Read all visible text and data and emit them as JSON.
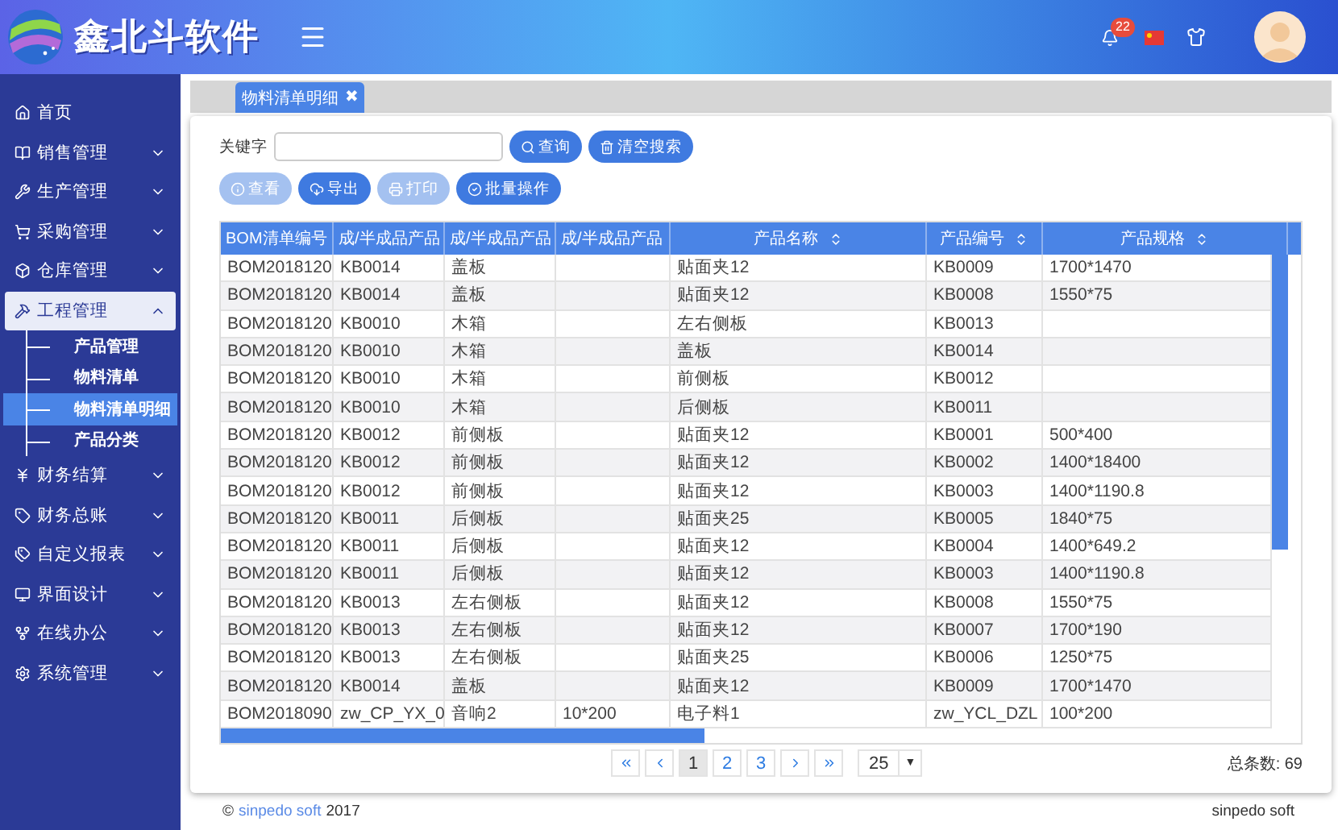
{
  "header": {
    "logo_text": "鑫北斗软件",
    "notifications": "22"
  },
  "sidebar": {
    "items": [
      {
        "label": "首页",
        "kind": "link"
      },
      {
        "label": "销售管理",
        "kind": "group",
        "expanded": false
      },
      {
        "label": "生产管理",
        "kind": "group",
        "expanded": false
      },
      {
        "label": "采购管理",
        "kind": "group",
        "expanded": false
      },
      {
        "label": "仓库管理",
        "kind": "group",
        "expanded": false
      },
      {
        "label": "工程管理",
        "kind": "group",
        "expanded": true,
        "children": [
          {
            "label": "产品管理",
            "selected": false
          },
          {
            "label": "物料清单",
            "selected": false
          },
          {
            "label": "物料清单明细",
            "selected": true
          },
          {
            "label": "产品分类",
            "selected": false
          }
        ]
      },
      {
        "label": "财务结算",
        "kind": "group",
        "expanded": false
      },
      {
        "label": "财务总账",
        "kind": "group",
        "expanded": false
      },
      {
        "label": "自定义报表",
        "kind": "group",
        "expanded": false
      },
      {
        "label": "界面设计",
        "kind": "group",
        "expanded": false
      },
      {
        "label": "在线办公",
        "kind": "group",
        "expanded": false
      },
      {
        "label": "系统管理",
        "kind": "group",
        "expanded": false
      }
    ]
  },
  "tabs": [
    {
      "label": "物料清单明细",
      "selected": true,
      "close": "✖"
    }
  ],
  "search": {
    "label": "关键字",
    "buttons": [
      "查询",
      "清空搜索"
    ]
  },
  "actions": [
    {
      "label": "查看",
      "disabled": true
    },
    {
      "label": "导出",
      "disabled": false
    },
    {
      "label": "打印",
      "disabled": true
    },
    {
      "label": "批量操作",
      "disabled": false
    }
  ],
  "table": {
    "columns": [
      {
        "label": "BOM清单编号",
        "sortable": false
      },
      {
        "label": "成/半成品产品",
        "sortable": false
      },
      {
        "label": "成/半成品产品",
        "sortable": false
      },
      {
        "label": "成/半成品产品",
        "sortable": false
      },
      {
        "label": "产品名称",
        "sortable": true
      },
      {
        "label": "产品编号",
        "sortable": true
      },
      {
        "label": "产品规格",
        "sortable": true
      }
    ],
    "rows": [
      [
        "BOM2018120",
        "KB0014",
        "盖板",
        "",
        "贴面夹12",
        "KB0009",
        "1700*1470"
      ],
      [
        "BOM2018120",
        "KB0014",
        "盖板",
        "",
        "贴面夹12",
        "KB0008",
        "1550*75"
      ],
      [
        "BOM2018120",
        "KB0010",
        "木箱",
        "",
        "左右侧板",
        "KB0013",
        ""
      ],
      [
        "BOM2018120",
        "KB0010",
        "木箱",
        "",
        "盖板",
        "KB0014",
        ""
      ],
      [
        "BOM2018120",
        "KB0010",
        "木箱",
        "",
        "前侧板",
        "KB0012",
        ""
      ],
      [
        "BOM2018120",
        "KB0010",
        "木箱",
        "",
        "后侧板",
        "KB0011",
        ""
      ],
      [
        "BOM2018120",
        "KB0012",
        "前侧板",
        "",
        "贴面夹12",
        "KB0001",
        "500*400"
      ],
      [
        "BOM2018120",
        "KB0012",
        "前侧板",
        "",
        "贴面夹12",
        "KB0002",
        "1400*18400"
      ],
      [
        "BOM2018120",
        "KB0012",
        "前侧板",
        "",
        "贴面夹12",
        "KB0003",
        "1400*1190.8"
      ],
      [
        "BOM2018120",
        "KB0011",
        "后侧板",
        "",
        "贴面夹25",
        "KB0005",
        "1840*75"
      ],
      [
        "BOM2018120",
        "KB0011",
        "后侧板",
        "",
        "贴面夹12",
        "KB0004",
        "1400*649.2"
      ],
      [
        "BOM2018120",
        "KB0011",
        "后侧板",
        "",
        "贴面夹12",
        "KB0003",
        "1400*1190.8"
      ],
      [
        "BOM2018120",
        "KB0013",
        "左右侧板",
        "",
        "贴面夹12",
        "KB0008",
        "1550*75"
      ],
      [
        "BOM2018120",
        "KB0013",
        "左右侧板",
        "",
        "贴面夹12",
        "KB0007",
        "1700*190"
      ],
      [
        "BOM2018120",
        "KB0013",
        "左右侧板",
        "",
        "贴面夹25",
        "KB0006",
        "1250*75"
      ],
      [
        "BOM2018120",
        "KB0014",
        "盖板",
        "",
        "贴面夹12",
        "KB0009",
        "1700*1470"
      ],
      [
        "BOM2018090",
        "zw_CP_YX_0",
        "音响2",
        "10*200",
        "电子料1",
        "zw_YCL_DZL",
        "100*200"
      ]
    ]
  },
  "pagination": {
    "pages": [
      {
        "label": "1",
        "selected": true
      },
      {
        "label": "2",
        "selected": false
      },
      {
        "label": "3",
        "selected": false
      }
    ],
    "page_size": "25",
    "caret": "▼",
    "total": "总条数: 69"
  },
  "footer": {
    "copyright": "©",
    "company": "sinpedo soft",
    "year": "2017",
    "brand": "sinpedo soft"
  }
}
